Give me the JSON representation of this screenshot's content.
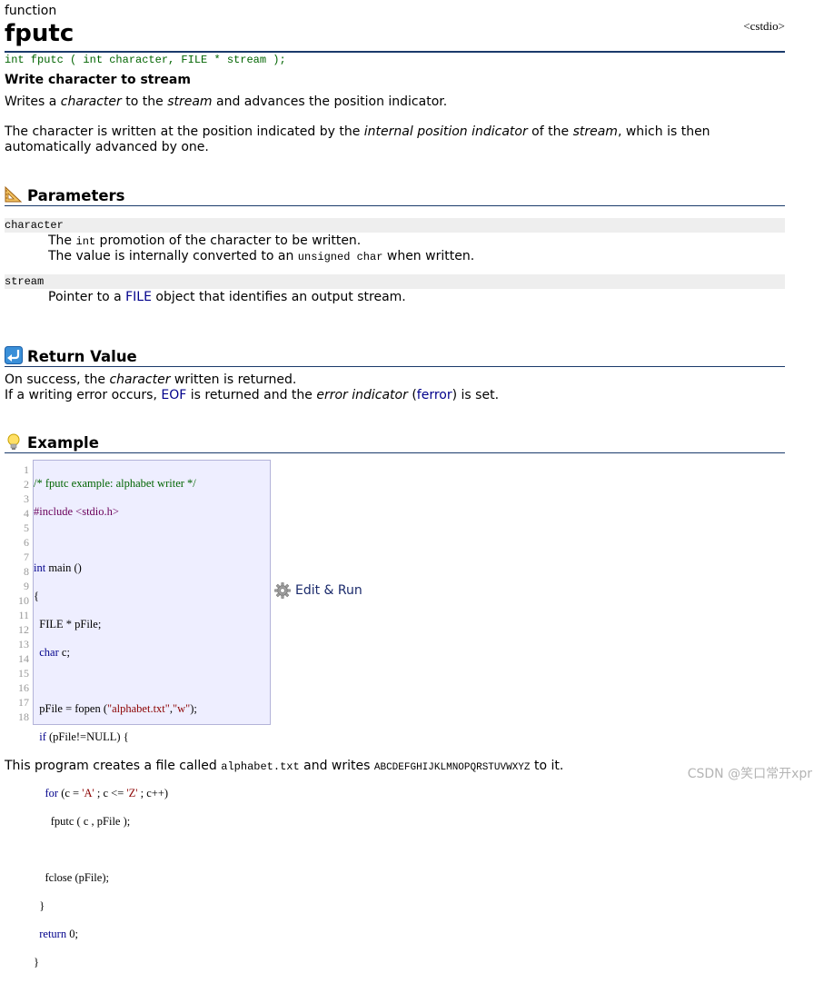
{
  "header": {
    "kind": "function",
    "title": "fputc",
    "library": "<cstdio>",
    "prototype": "int fputc ( int character, FILE * stream );",
    "brief": "Write character to stream"
  },
  "description": {
    "p1_pre": "Writes a ",
    "p1_em1": "character",
    "p1_mid": " to the ",
    "p1_em2": "stream",
    "p1_post": " and advances the position indicator.",
    "p2_pre": "The character is written at the position indicated by the ",
    "p2_em1": "internal position indicator",
    "p2_mid": " of the ",
    "p2_em2": "stream",
    "p2_post": ", which is then automatically advanced by one."
  },
  "sections": {
    "parameters": "Parameters",
    "return_value": "Return Value",
    "example": "Example"
  },
  "parameters": [
    {
      "name": "character",
      "l1_pre": "The ",
      "l1_code": "int",
      "l1_post": " promotion of the character to be written.",
      "l2_pre": "The value is internally converted to an ",
      "l2_code": "unsigned char",
      "l2_post": " when written."
    },
    {
      "name": "stream",
      "l1_pre": "Pointer to a ",
      "l1_link": "FILE",
      "l1_post": " object that identifies an output stream."
    }
  ],
  "return_value": {
    "l1_pre": "On success, the ",
    "l1_em": "character",
    "l1_post": " written is returned.",
    "l2_pre": "If a writing error occurs, ",
    "l2_link1": "EOF",
    "l2_mid": " is returned and the ",
    "l2_em": "error indicator",
    "l2_open": " (",
    "l2_link2": "ferror",
    "l2_post": ") is set."
  },
  "example": {
    "line_numbers": [
      "1",
      "2",
      "3",
      "4",
      "5",
      "6",
      "7",
      "8",
      "9",
      "10",
      "11",
      "12",
      "13",
      "14",
      "15",
      "16",
      "17",
      "18"
    ],
    "code": {
      "l1": "/* fputc example: alphabet writer */",
      "l2": "#include <stdio.h>",
      "l4_kw": "int",
      "l4_rest": " main ()",
      "l5": "{",
      "l6": "  FILE * pFile;",
      "l7_kw": "char",
      "l7_rest": " c;",
      "l9_a": "  pFile = fopen (",
      "l9_s1": "\"alphabet.txt\"",
      "l9_b": ",",
      "l9_s2": "\"w\"",
      "l9_c": ");",
      "l10_kw": "if",
      "l10_rest": " (pFile!=NULL) {",
      "l12_kw": "for",
      "l12_a": " (c = ",
      "l12_s1": "'A'",
      "l12_b": " ; c <= ",
      "l12_s2": "'Z'",
      "l12_c": " ; c++)",
      "l13": "      fputc ( c , pFile );",
      "l15": "    fclose (pFile);",
      "l16": "  }",
      "l17_kw": "return",
      "l17_rest": " 0;",
      "l18": "}"
    },
    "edit_run_label": "Edit & Run",
    "outro_pre": "This program creates a file called ",
    "outro_code1": "alphabet.txt",
    "outro_mid": " and writes ",
    "outro_code2": "ABCDEFGHIJKLMNOPQRSTUVWXYZ",
    "outro_post": " to it."
  },
  "watermark": "CSDN @笑口常开xpr",
  "colors": {
    "rule": "#1a3a6b",
    "prototype": "#006400",
    "link": "#00008b",
    "code_bg": "#eeeeff"
  },
  "icons": {
    "parameters": "triangle-ruler-icon",
    "return_value": "return-arrow-icon",
    "example": "lightbulb-icon",
    "edit_run": "gear-icon"
  }
}
